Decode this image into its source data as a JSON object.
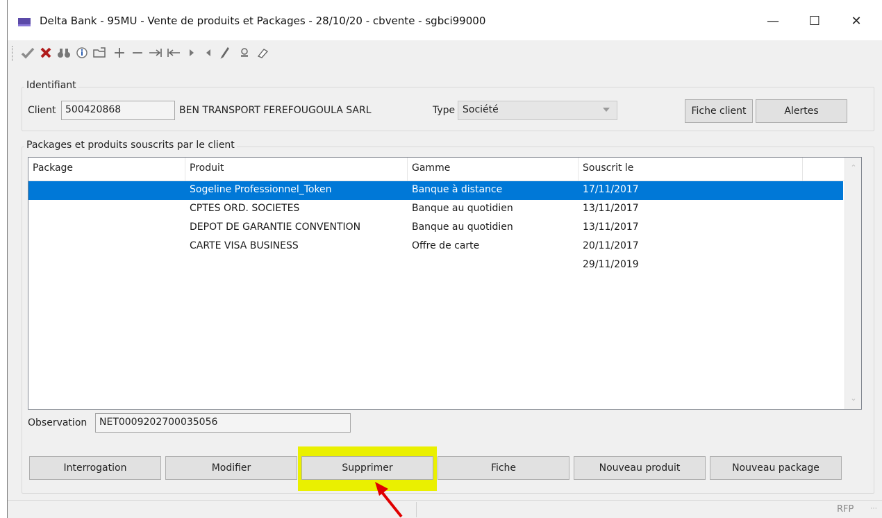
{
  "window": {
    "title": "Delta Bank - 95MU - Vente de produits et Packages - 28/10/20 - cbvente - sgbci99000",
    "minimize": "—",
    "maximize": "☐",
    "close": "✕"
  },
  "toolbar": {
    "icons": [
      "check-icon",
      "cross-icon",
      "binoculars-icon",
      "info-icon",
      "open-folder-icon",
      "plus-icon",
      "minus-icon",
      "last-icon",
      "first-icon",
      "next-icon",
      "previous-icon",
      "pencil-icon",
      "stamp-icon",
      "eraser-icon"
    ]
  },
  "identifiant": {
    "group_label": "Identifiant",
    "client_label": "Client",
    "client_value": "500420868",
    "client_name": "BEN TRANSPORT FEREFOUGOULA SARL",
    "type_label": "Type",
    "type_value": "Société",
    "fiche_client": "Fiche client",
    "alertes": "Alertes"
  },
  "packages": {
    "group_label": "Packages et produits souscrits par le client",
    "columns": [
      "Package",
      "Produit",
      "Gamme",
      "Souscrit le"
    ],
    "rows": [
      {
        "package": "",
        "produit": "Sogeline Professionnel_Token",
        "gamme": "Banque à distance",
        "souscrit": "17/11/2017",
        "selected": true
      },
      {
        "package": "",
        "produit": "CPTES ORD. SOCIETES",
        "gamme": "Banque au quotidien",
        "souscrit": "13/11/2017",
        "selected": false
      },
      {
        "package": "",
        "produit": "DEPOT DE GARANTIE CONVENTION",
        "gamme": "Banque au quotidien",
        "souscrit": "13/11/2017",
        "selected": false
      },
      {
        "package": "",
        "produit": "CARTE VISA BUSINESS",
        "gamme": "Offre de carte",
        "souscrit": "20/11/2017",
        "selected": false
      },
      {
        "package": "",
        "produit": "",
        "gamme": "",
        "souscrit": "29/11/2019",
        "selected": false
      }
    ]
  },
  "observation": {
    "label": "Observation",
    "value": "NET0009202700035056"
  },
  "actions": {
    "interrogation": "Interrogation",
    "modifier": "Modifier",
    "supprimer": "Supprimer",
    "fiche": "Fiche",
    "nouveau_produit": "Nouveau produit",
    "nouveau_package": "Nouveau package"
  },
  "statusbar": {
    "rfp": "RFP"
  },
  "colors": {
    "selection": "#0078d7",
    "highlight": "#eaf000",
    "annotation_arrow": "#e00000"
  }
}
